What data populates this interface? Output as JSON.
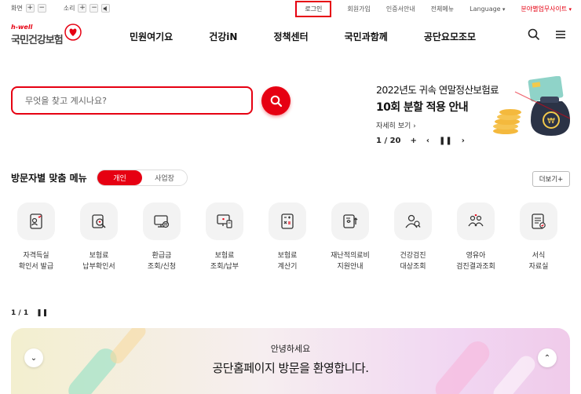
{
  "utility": {
    "screen_label": "화면",
    "sound_label": "소리",
    "plus": "+",
    "minus": "−",
    "login": "로그인",
    "signup": "회원가입",
    "cert": "인증서안내",
    "allmenu": "전체메뉴",
    "language": "Language",
    "biz_site": "분야별업무사이트"
  },
  "logo": {
    "hwell": "h-well",
    "name": "국민건강보험"
  },
  "gnb": [
    "민원여기요",
    "건강iN",
    "정책센터",
    "국민과함께",
    "공단요모조모"
  ],
  "search": {
    "placeholder": "무엇을 찾고 계시나요?"
  },
  "banner": {
    "title1": "2022년도 귀속 연말정산보험료",
    "title2": "10회 분할 적용 안내",
    "more": "자세히 보기 ›",
    "counter": "1 / 20",
    "plus": "+"
  },
  "section": {
    "title": "방문자별 맞춤 메뉴",
    "tab_personal": "개인",
    "tab_business": "사업장",
    "more": "더보기+"
  },
  "menu_items": [
    {
      "label": "자격득실\n확인서 발급",
      "icon": "certificate-icon"
    },
    {
      "label": "보험료\n납부확인서",
      "icon": "receipt-search-icon"
    },
    {
      "label": "환급금\n조회/신청",
      "icon": "refund-monitor-icon"
    },
    {
      "label": "보험료\n조회/납부",
      "icon": "payment-monitor-icon"
    },
    {
      "label": "보험료\n계산기",
      "icon": "calculator-icon"
    },
    {
      "label": "재난적의료비\n지원안내",
      "icon": "medical-support-icon"
    },
    {
      "label": "건강검진\n대상조회",
      "icon": "people-search-icon"
    },
    {
      "label": "영유아\n검진결과조회",
      "icon": "family-icon"
    },
    {
      "label": "서식\n자료실",
      "icon": "document-form-icon"
    }
  ],
  "pager": {
    "counter": "1 / 1"
  },
  "hero": {
    "greeting": "안녕하세요",
    "welcome": "공단홈페이지 방문을 환영합니다."
  },
  "colors": {
    "accent": "#e60012"
  }
}
